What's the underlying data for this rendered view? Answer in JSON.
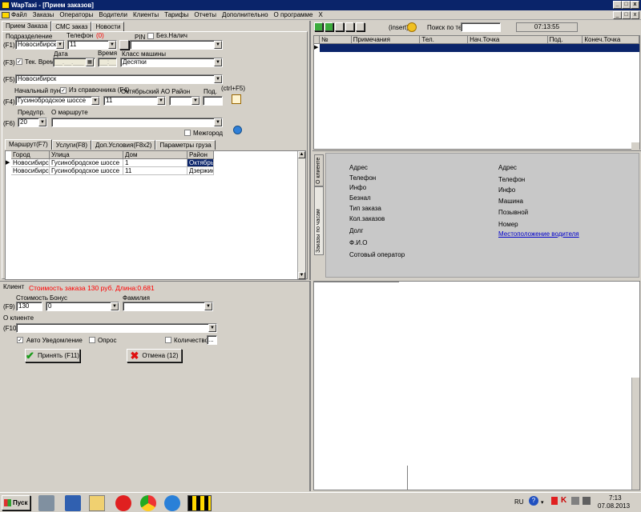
{
  "window": {
    "title": "WapTaxi - [Прием заказов]"
  },
  "menu": [
    "Файл",
    "Заказы",
    "Операторы",
    "Водители",
    "Клиенты",
    "Тарифы",
    "Отчеты",
    "Дополнительно",
    "О программе",
    "X"
  ],
  "tabs": [
    "Прием Заказа",
    "СМС заказ",
    "Новости"
  ],
  "form": {
    "podrazdelenie_label": "Подразделение",
    "telefon_label": "Телефон",
    "telefon_count": "(0)",
    "pin_label": "PIN",
    "beznal_label": "Без.Налич",
    "f1": "(F1)",
    "podrazdelenie_value": "Новосибирск",
    "telefon_value": "11",
    "date_label": "Дата",
    "time_label": "Время",
    "class_label": "Класс машины",
    "f3": "(F3)",
    "tek_vrem": "Тек. Врем",
    "date_value": "__.__.___",
    "time_value": "__:__",
    "class_value": "Десятки",
    "f5": "(F5)",
    "city_value": "Новосибирск",
    "start_label": "Начальный пункт",
    "from_sprav": "Из справочника (F4)",
    "rayon_label": "Октябрьский АО Район",
    "pod_label": "Под.",
    "ctrl_f5": "(ctrl+F5)",
    "f4": "(F4)",
    "street_value": "Гусинобродское шоссе",
    "house_value": "11",
    "predupr_label": "Предупр.",
    "marshrut_label": "О маршруте",
    "f6": "(F6)",
    "predupr_value": "20",
    "mezhgorod": "Межгород"
  },
  "route_tabs": [
    "Маршрут(F7)",
    "Услуги(F8)",
    "Доп.Условия(F8x2)",
    "Параметры груза"
  ],
  "route_table": {
    "headers": [
      "Город",
      "Улица",
      "Дом",
      "Район"
    ],
    "rows": [
      [
        "Новосибирск",
        "Гусинобродское шоссе",
        "1",
        "Октябрьс"
      ],
      [
        "Новосибирск",
        "Гусинобродское шоссе",
        "11",
        "Дзержин"
      ]
    ]
  },
  "client": {
    "label": "Клиент",
    "cost_text": "Стоимость заказа 130 руб. Длина:0.681",
    "stoimost_label": "Стоимость",
    "bonus_label": "Бонус",
    "familiya_label": "Фамилия",
    "f9": "(F9)",
    "stoimost_value": "130",
    "bonus_value": "0",
    "about_label": "О клиенте",
    "f10": "(F10)",
    "auto_notify": "Авто Уведомление",
    "opros": "Опрос",
    "kolichestvo": "Количество",
    "kol_value": "..."
  },
  "buttons": {
    "accept": "Принять (F11)",
    "cancel": "Отмена (12)"
  },
  "toolbar": {
    "insert": "(insert)",
    "search_label": "Поиск по тел",
    "clock": "07:13:55"
  },
  "orders_table": {
    "headers": [
      "№",
      "Примечания",
      "Тел.",
      "Нач.Точка",
      "Под.",
      "Конеч.Точка"
    ]
  },
  "side_tabs": [
    "О клиенте",
    "Заказы по часам"
  ],
  "info_left": [
    "Адрес",
    "Телефон",
    "Инфо",
    "Безнал",
    "Тип заказа",
    "Кол.заказов",
    "Долг",
    "Ф.И.О",
    "Сотовый оператор"
  ],
  "info_right": [
    "Адрес",
    "Телефон",
    "Инфо",
    "Машина",
    "Позывной",
    "Номер"
  ],
  "driver_link": "Местоположение водителя",
  "taskbar": {
    "start": "Пуск",
    "lang": "RU",
    "time": "7:13",
    "date": "07.08.2013"
  }
}
